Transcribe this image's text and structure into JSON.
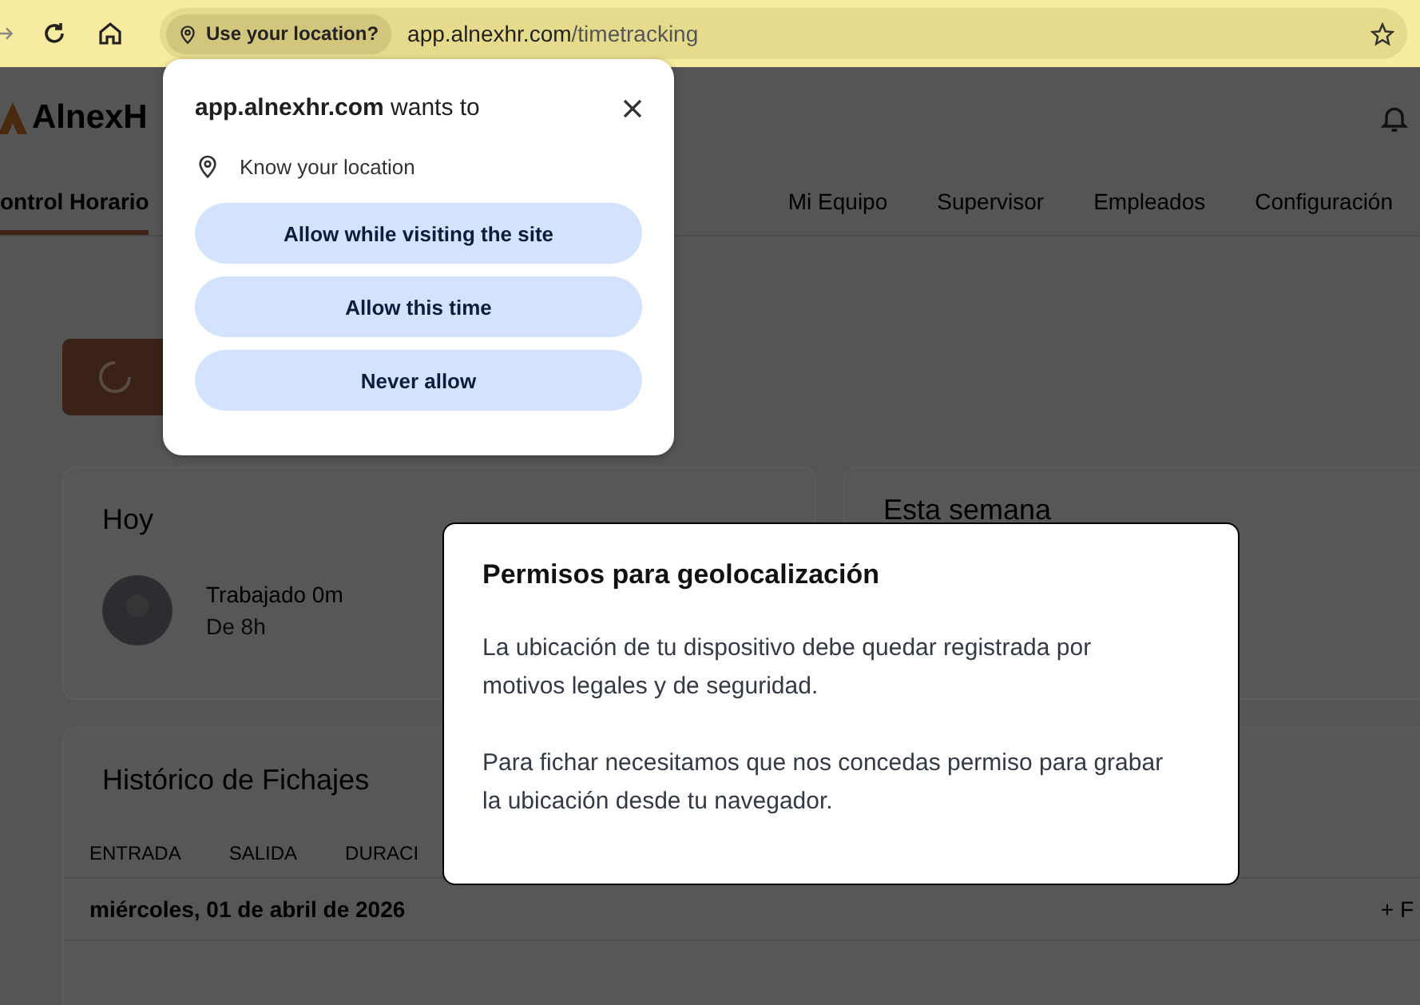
{
  "browser": {
    "location_chip": "Use your location?",
    "url_host": "app.alnexhr.com",
    "url_path": "/timetracking"
  },
  "permission_popup": {
    "title": "**app.alnexhr.com** wants to",
    "permission": "Know your location",
    "buttons": [
      "Allow while visiting the site",
      "Allow this time",
      "Never allow"
    ]
  },
  "app": {
    "logo": "AlnexH",
    "nav": [
      {
        "label": "ontrol Horario",
        "selected": true
      },
      {
        "label": "Mi Equipo",
        "selected": false
      },
      {
        "label": "Supervisor",
        "selected": false
      },
      {
        "label": "Empleados",
        "selected": false
      },
      {
        "label": "Configuración",
        "selected": false
      }
    ],
    "today": {
      "title": "Hoy",
      "worked": "Trabajado 0m",
      "target": "De 8h"
    },
    "week": {
      "title": "Esta semana"
    },
    "history": {
      "title": "Histórico de Fichajes",
      "columns": [
        "ENTRADA",
        "SALIDA",
        "DURACI"
      ],
      "rows": [
        {
          "date": "miércoles, 01 de abril de 2026",
          "action": "+ F"
        }
      ]
    }
  },
  "modal": {
    "title": "Permisos para geolocalización",
    "paragraphs": [
      "La ubicación de tu dispositivo debe quedar registrada por motivos legales y de seguridad.",
      "Para fichar necesitamos que nos concedas permiso para grabar la ubicación desde tu navegador."
    ]
  }
}
